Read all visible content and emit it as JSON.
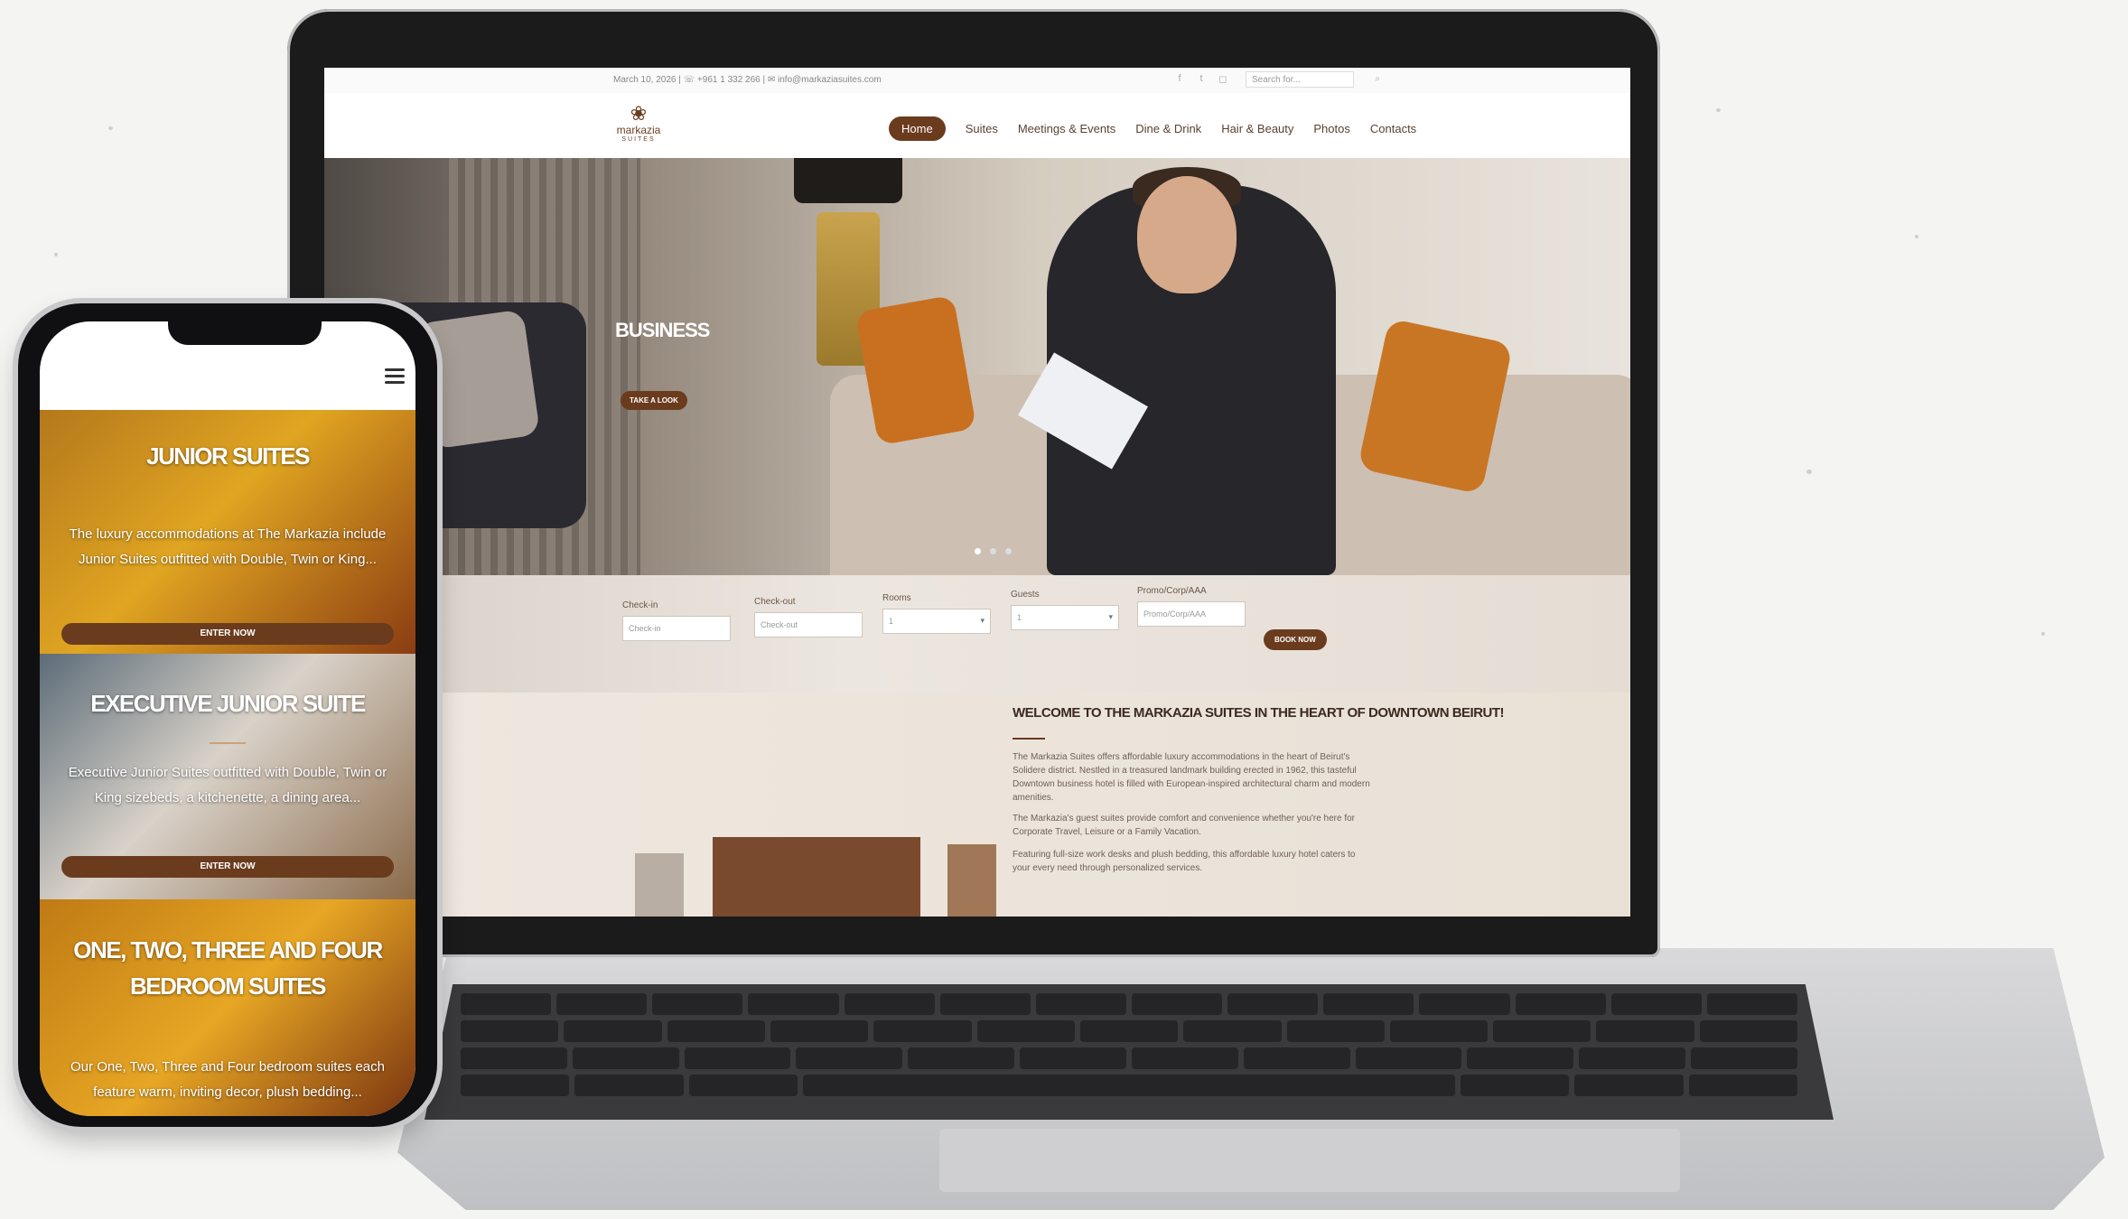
{
  "site": {
    "topbar": {
      "info": "March 10, 2026 | ☏ +961 1 332 266 | ✉ info@markaziasuites.com",
      "search_placeholder": "Search for..."
    },
    "logo": {
      "name": "markazia",
      "sub": "SUITES"
    },
    "nav": [
      "Home",
      "Suites",
      "Meetings & Events",
      "Dine & Drink",
      "Hair & Beauty",
      "Photos",
      "Contacts"
    ],
    "hero": {
      "title": "BUSINESS",
      "button": "TAKE A LOOK"
    },
    "booking": {
      "checkin_label": "Check-in",
      "checkin_placeholder": "Check-in",
      "checkout_label": "Check-out",
      "checkout_placeholder": "Check-out",
      "rooms_label": "Rooms",
      "rooms_value": "1",
      "guests_label": "Guests",
      "guests_value": "1",
      "promo_label": "Promo/Corp/AAA",
      "promo_placeholder": "Promo/Corp/AAA",
      "book_button": "BOOK NOW"
    },
    "welcome": {
      "title": "WELCOME TO THE MARKAZIA SUITES IN THE HEART OF DOWNTOWN BEIRUT!",
      "p1": "The Markazia Suites offers affordable luxury accommodations in the heart of Beirut's Solidere district. Nestled in a treasured landmark building erected in 1962, this tasteful Downtown business hotel is filled with European-inspired architectural charm and modern amenities.",
      "p2": "The Markazia's guest suites provide comfort and convenience whether you're here for Corporate Travel, Leisure or a Family Vacation.",
      "p3": "Featuring full-size work desks and plush bedding, this affordable luxury hotel caters to your every need through personalized services."
    }
  },
  "phone": {
    "panels": [
      {
        "title": "JUNIOR SUITES",
        "text": "The luxury accommodations at The Markazia include Junior Suites outfitted with Double, Twin or King...",
        "button": "ENTER NOW"
      },
      {
        "title": "EXECUTIVE JUNIOR SUITE",
        "text": "Executive Junior Suites outfitted with Double, Twin or King sizebeds, a kitchenette, a dining area...",
        "button": "ENTER NOW"
      },
      {
        "title": "ONE, TWO, THREE AND FOUR BEDROOM SUITES",
        "text": "Our One, Two, Three and Four bedroom suites each feature warm, inviting decor, plush bedding..."
      }
    ]
  },
  "colors": {
    "brand": "#6b3b1e",
    "background": "#f4f4f2"
  },
  "icons": [
    "facebook-icon",
    "twitter-icon",
    "instagram-icon",
    "search-icon",
    "hamburger-menu-icon",
    "chevron-down-icon"
  ]
}
